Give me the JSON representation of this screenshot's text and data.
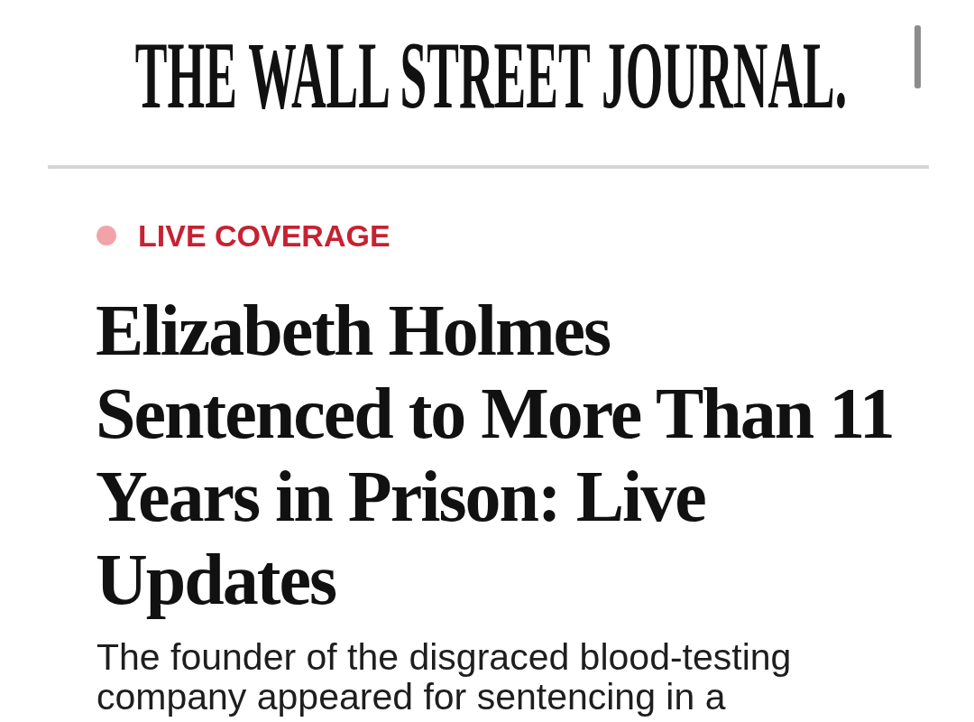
{
  "masthead": {
    "title": "THE WALL STREET JOURNAL."
  },
  "label": {
    "text": "LIVE COVERAGE"
  },
  "article": {
    "headline": "Elizabeth Holmes Sentenced to More Than 11 Years in Prison: Live Updates",
    "summary": "The founder of the disgraced blood-testing company appeared for sentencing in a"
  }
}
